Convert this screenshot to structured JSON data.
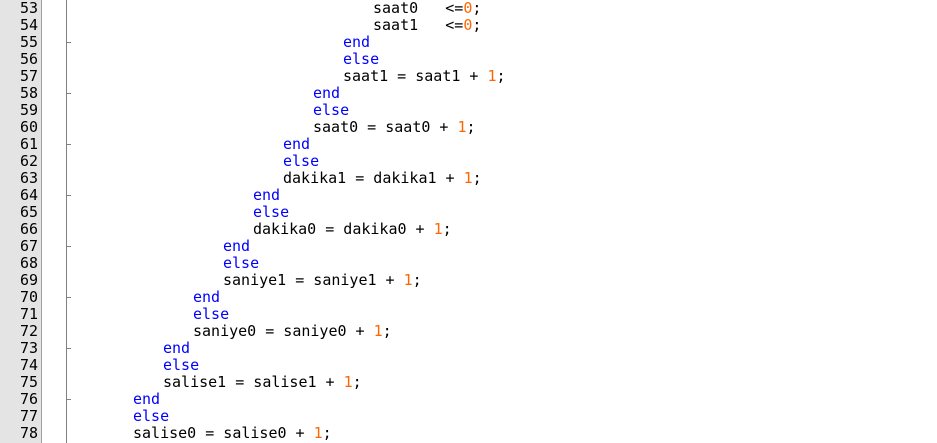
{
  "editor": {
    "colors": {
      "keyword": "#0000ff",
      "number": "#ff6600",
      "text": "#000000",
      "gutter": "#e4e4e4"
    },
    "lines": [
      {
        "num": "53",
        "indent": 12,
        "tokens": [
          {
            "t": "saat0   <=",
            "c": "txt"
          },
          {
            "t": "0",
            "c": "num"
          },
          {
            "t": ";",
            "c": "txt"
          }
        ],
        "tick": false
      },
      {
        "num": "54",
        "indent": 12,
        "tokens": [
          {
            "t": "saat1   <=",
            "c": "txt"
          },
          {
            "t": "0",
            "c": "num"
          },
          {
            "t": ";",
            "c": "txt"
          }
        ],
        "tick": false
      },
      {
        "num": "55",
        "indent": 11,
        "tokens": [
          {
            "t": "end",
            "c": "kw"
          }
        ],
        "tick": true
      },
      {
        "num": "56",
        "indent": 11,
        "tokens": [
          {
            "t": "else",
            "c": "kw"
          }
        ],
        "tick": false
      },
      {
        "num": "57",
        "indent": 11,
        "tokens": [
          {
            "t": "saat1 = saat1 + ",
            "c": "txt"
          },
          {
            "t": "1",
            "c": "num"
          },
          {
            "t": ";",
            "c": "txt"
          }
        ],
        "tick": false
      },
      {
        "num": "58",
        "indent": 10,
        "tokens": [
          {
            "t": "end",
            "c": "kw"
          }
        ],
        "tick": true
      },
      {
        "num": "59",
        "indent": 10,
        "tokens": [
          {
            "t": "else",
            "c": "kw"
          }
        ],
        "tick": false
      },
      {
        "num": "60",
        "indent": 10,
        "tokens": [
          {
            "t": "saat0 = saat0 + ",
            "c": "txt"
          },
          {
            "t": "1",
            "c": "num"
          },
          {
            "t": ";",
            "c": "txt"
          }
        ],
        "tick": false
      },
      {
        "num": "61",
        "indent": 9,
        "tokens": [
          {
            "t": "end",
            "c": "kw"
          }
        ],
        "tick": true
      },
      {
        "num": "62",
        "indent": 9,
        "tokens": [
          {
            "t": "else",
            "c": "kw"
          }
        ],
        "tick": false
      },
      {
        "num": "63",
        "indent": 9,
        "tokens": [
          {
            "t": "dakika1 = dakika1 + ",
            "c": "txt"
          },
          {
            "t": "1",
            "c": "num"
          },
          {
            "t": ";",
            "c": "txt"
          }
        ],
        "tick": false
      },
      {
        "num": "64",
        "indent": 8,
        "tokens": [
          {
            "t": "end",
            "c": "kw"
          }
        ],
        "tick": true
      },
      {
        "num": "65",
        "indent": 8,
        "tokens": [
          {
            "t": "else",
            "c": "kw"
          }
        ],
        "tick": false
      },
      {
        "num": "66",
        "indent": 8,
        "tokens": [
          {
            "t": "dakika0 = dakika0 + ",
            "c": "txt"
          },
          {
            "t": "1",
            "c": "num"
          },
          {
            "t": ";",
            "c": "txt"
          }
        ],
        "tick": false
      },
      {
        "num": "67",
        "indent": 7,
        "tokens": [
          {
            "t": "end",
            "c": "kw"
          }
        ],
        "tick": true
      },
      {
        "num": "68",
        "indent": 7,
        "tokens": [
          {
            "t": "else",
            "c": "kw"
          }
        ],
        "tick": false
      },
      {
        "num": "69",
        "indent": 7,
        "tokens": [
          {
            "t": "saniye1 = saniye1 + ",
            "c": "txt"
          },
          {
            "t": "1",
            "c": "num"
          },
          {
            "t": ";",
            "c": "txt"
          }
        ],
        "tick": false
      },
      {
        "num": "70",
        "indent": 6,
        "tokens": [
          {
            "t": "end",
            "c": "kw"
          }
        ],
        "tick": true
      },
      {
        "num": "71",
        "indent": 6,
        "tokens": [
          {
            "t": "else",
            "c": "kw"
          }
        ],
        "tick": false
      },
      {
        "num": "72",
        "indent": 6,
        "tokens": [
          {
            "t": "saniye0 = saniye0 + ",
            "c": "txt"
          },
          {
            "t": "1",
            "c": "num"
          },
          {
            "t": ";",
            "c": "txt"
          }
        ],
        "tick": false
      },
      {
        "num": "73",
        "indent": 5,
        "tokens": [
          {
            "t": "end",
            "c": "kw"
          }
        ],
        "tick": true
      },
      {
        "num": "74",
        "indent": 5,
        "tokens": [
          {
            "t": "else",
            "c": "kw"
          }
        ],
        "tick": false
      },
      {
        "num": "75",
        "indent": 5,
        "tokens": [
          {
            "t": "salise1 = salise1 + ",
            "c": "txt"
          },
          {
            "t": "1",
            "c": "num"
          },
          {
            "t": ";",
            "c": "txt"
          }
        ],
        "tick": false
      },
      {
        "num": "76",
        "indent": 4,
        "tokens": [
          {
            "t": "end",
            "c": "kw"
          }
        ],
        "tick": true
      },
      {
        "num": "77",
        "indent": 4,
        "tokens": [
          {
            "t": "else",
            "c": "kw"
          }
        ],
        "tick": false
      },
      {
        "num": "78",
        "indent": 4,
        "tokens": [
          {
            "t": "salise0 = salise0 + ",
            "c": "txt"
          },
          {
            "t": "1",
            "c": "num"
          },
          {
            "t": ";",
            "c": "txt"
          }
        ],
        "tick": false
      }
    ]
  }
}
